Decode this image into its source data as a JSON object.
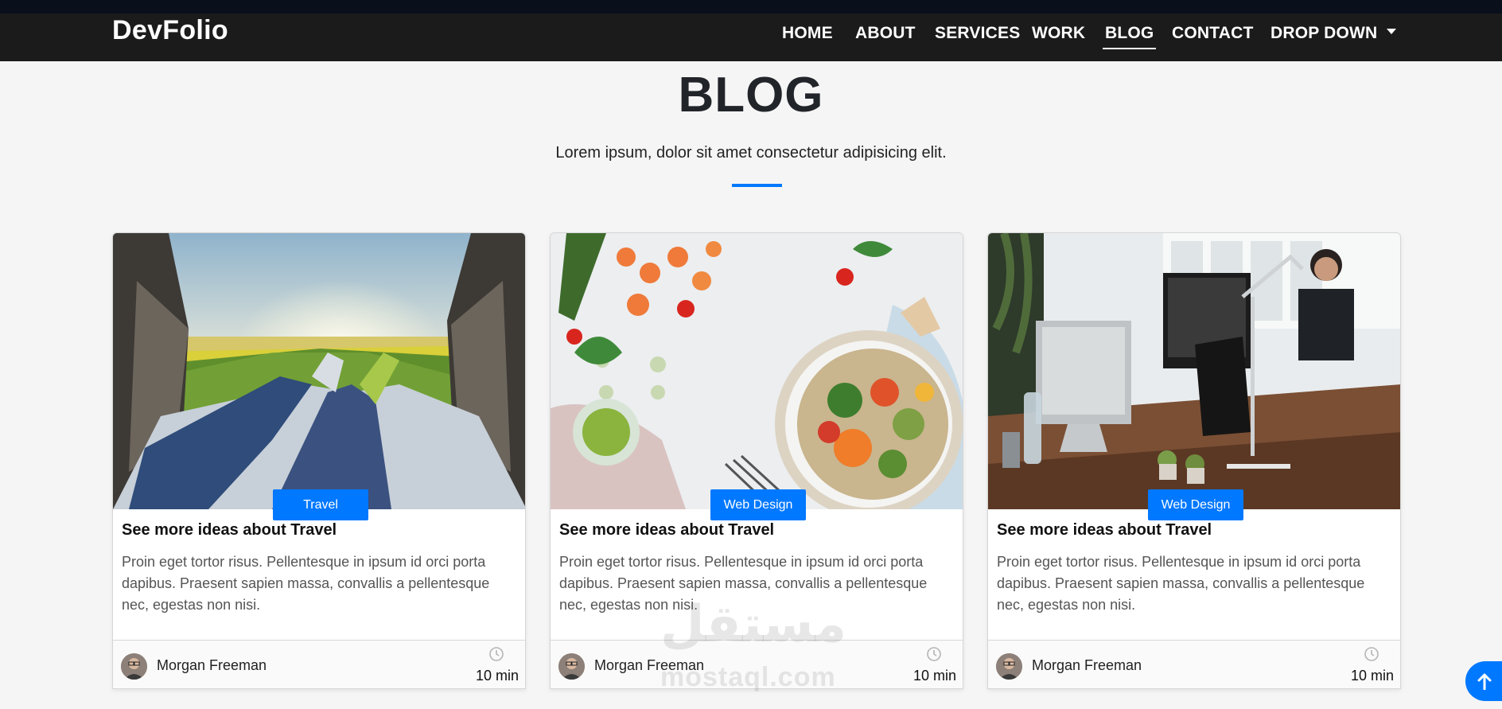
{
  "navbar": {
    "brand": "DevFolio",
    "items": [
      {
        "label": "HOME"
      },
      {
        "label": "ABOUT"
      },
      {
        "label": "SERVICES"
      },
      {
        "label": "WORK"
      },
      {
        "label": "BLOG",
        "active": true
      },
      {
        "label": "CONTACT"
      },
      {
        "label": "DROP DOWN"
      }
    ]
  },
  "section": {
    "title": "BLOG",
    "subtitle": "Lorem ipsum, dolor sit amet consectetur adipisicing elit.",
    "accent_color": "#0078ff"
  },
  "cards": [
    {
      "image": "travel-photo",
      "category": "Travel",
      "title": "See more ideas about Travel",
      "text": "Proin eget tortor risus. Pellentesque in ipsum id orci porta dapibus. Praesent sapien massa, convallis a pellentesque nec, egestas non nisi.",
      "author": "Morgan Freeman",
      "time": "10 min"
    },
    {
      "image": "food-photo",
      "category": "Web Design",
      "title": "See more ideas about Travel",
      "text": "Proin eget tortor risus. Pellentesque in ipsum id orci porta dapibus. Praesent sapien massa, convallis a pellentesque nec, egestas non nisi.",
      "author": "Morgan Freeman",
      "time": "10 min"
    },
    {
      "image": "office-photo",
      "category": "Web Design",
      "title": "See more ideas about Travel",
      "text": "Proin eget tortor risus. Pellentesque in ipsum id orci porta dapibus. Praesent sapien massa, convallis a pellentesque nec, egestas non nisi.",
      "author": "Morgan Freeman",
      "time": "10 min"
    }
  ],
  "watermark": {
    "arabic": "مستقل",
    "latin": "mostaql.com"
  },
  "back_to_top": {
    "icon": "arrow-up-icon"
  }
}
